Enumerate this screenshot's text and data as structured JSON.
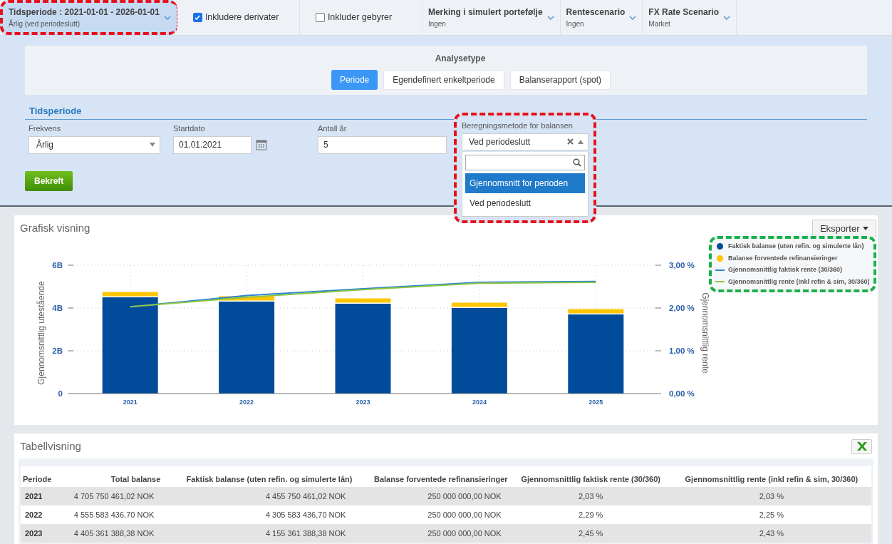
{
  "top_bar": [
    {
      "kind": "filter",
      "label": "Tidsperiode : 2021-01-01 - 2026-01-01",
      "value": "Årlig (ved periodeslutt)",
      "selected": true,
      "highlight": {
        "color": "#e8101a"
      }
    },
    {
      "kind": "checkbox",
      "label": "Inkludere derivater",
      "checked": true
    },
    {
      "kind": "checkbox",
      "label": "Inkluder gebyrer",
      "checked": false
    },
    {
      "kind": "filter",
      "label": "Merking i simulert portefølje",
      "value": "Ingen",
      "selected": false
    },
    {
      "kind": "filter",
      "label": "Rentescenario",
      "value": "Ingen",
      "selected": false
    },
    {
      "kind": "filter",
      "label": "FX Rate Scenario",
      "value": "Market",
      "selected": false
    }
  ],
  "analysis": {
    "title": "Analysetype",
    "tabs": [
      {
        "label": "Periode",
        "selected": true
      },
      {
        "label": "Egendefinert enkeltperiode",
        "selected": false
      },
      {
        "label": "Balanserapport (spot)",
        "selected": false
      }
    ]
  },
  "period_form": {
    "title": "Tidsperiode",
    "frequency": {
      "label": "Frekvens",
      "value": "Årlig"
    },
    "start_date": {
      "label": "Startdato",
      "value": "01.01.2021"
    },
    "years": {
      "label": "Antall år",
      "value": "5"
    },
    "method": {
      "label": "Beregningsmetode for balansen",
      "value": "Ved periodeslutt",
      "expanded": true,
      "highlight": {
        "color": "#e8101a"
      },
      "options": [
        {
          "label": "Gjennomsnitt for perioden",
          "highlighted": true
        },
        {
          "label": "Ved periodeslutt",
          "highlighted": false
        }
      ]
    },
    "confirm_button": "Bekreft"
  },
  "chart_panel": {
    "title": "Grafisk visning",
    "export_button": "Eksporter",
    "legend_highlight": {
      "color": "#19b04b"
    },
    "chart_data": {
      "type": "bar",
      "stacked": true,
      "grid": true,
      "ylabel": "Gjennomsnittlig utestående",
      "y2label": "Gjennomsnittlig rente",
      "categories": [
        "2021",
        "2022",
        "2023",
        "2024",
        "2025"
      ],
      "ylim": [
        0,
        6
      ],
      "yticks": [
        {
          "value": 0,
          "label": "0"
        },
        {
          "value": 2,
          "label": "2B"
        },
        {
          "value": 4,
          "label": "4B"
        },
        {
          "value": 6,
          "label": "6B"
        }
      ],
      "y2lim": [
        0,
        3
      ],
      "y2ticks": [
        {
          "value": 0,
          "label": "0,00 %"
        },
        {
          "value": 1,
          "label": "1,00 %"
        },
        {
          "value": 2,
          "label": "2,00 %"
        },
        {
          "value": 3,
          "label": "3,00 %"
        }
      ],
      "series": [
        {
          "name": "Faktisk balanse (uten refin. og simulerte lån)",
          "type": "bar",
          "color": "#004c9b",
          "values": [
            4.5,
            4.3,
            4.2,
            4.0,
            3.7
          ]
        },
        {
          "name": "Balanse forventede refinansieringer",
          "type": "bar",
          "color": "#ffc600",
          "values": [
            0.25,
            0.25,
            0.25,
            0.25,
            0.25
          ]
        },
        {
          "name": "Gjennomsnittlig faktisk rente (30/360)",
          "type": "line",
          "axis": "y2",
          "color": "#2b84d4",
          "values": [
            2.03,
            2.29,
            2.45,
            2.6,
            2.62
          ]
        },
        {
          "name": "Gjennomsnittlig rente (inkl refin & sim, 30/360)",
          "type": "line",
          "axis": "y2",
          "color": "#8dc63f",
          "values": [
            2.03,
            2.25,
            2.43,
            2.58,
            2.6
          ]
        }
      ]
    }
  },
  "table_panel": {
    "title": "Tabellvisning",
    "columns": [
      "Periode",
      "Total balanse",
      "Faktisk balanse (uten refin. og simulerte lån)",
      "Balanse forventede refinansieringer",
      "Gjennomsnittlig faktisk rente (30/360)",
      "Gjennomsnittlig rente (inkl refin & sim, 30/360)"
    ],
    "rows": [
      [
        "2021",
        "4 705 750 461,02 NOK",
        "4 455 750 461,02 NOK",
        "250 000 000,00 NOK",
        "2,03 %",
        "2,03 %"
      ],
      [
        "2022",
        "4 555 583 436,70 NOK",
        "4 305 583 436,70 NOK",
        "250 000 000,00 NOK",
        "2,29 %",
        "2,25 %"
      ],
      [
        "2023",
        "4 405 361 388,38 NOK",
        "4 155 361 388,38 NOK",
        "250 000 000,00 NOK",
        "2,45 %",
        "2,43 %"
      ]
    ]
  }
}
